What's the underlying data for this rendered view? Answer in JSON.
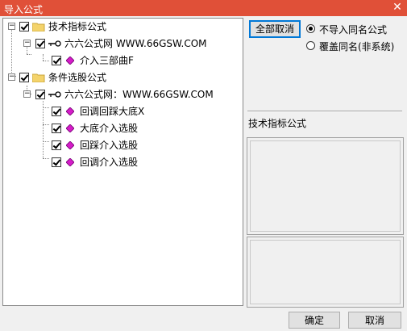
{
  "window": {
    "title": "导入公式",
    "close_symbol": "✕"
  },
  "tree": {
    "nodes": [
      {
        "label": "技术指标公式"
      },
      {
        "label": "六六公式网 WWW.66GSW.COM"
      },
      {
        "label": "介入三部曲F"
      },
      {
        "label": "条件选股公式"
      },
      {
        "label": "六六公式网：WWW.66GSW.COM"
      },
      {
        "label": "回调回踩大底X"
      },
      {
        "label": "大底介入选股"
      },
      {
        "label": "回踩介入选股"
      },
      {
        "label": "回调介入选股"
      }
    ]
  },
  "right": {
    "cancel_all": "全部取消",
    "radio_no_import": "不导入同名公式",
    "radio_overwrite": "覆盖同名(非系统)",
    "section_label": "技术指标公式"
  },
  "footer": {
    "ok": "确定",
    "cancel": "取消"
  }
}
